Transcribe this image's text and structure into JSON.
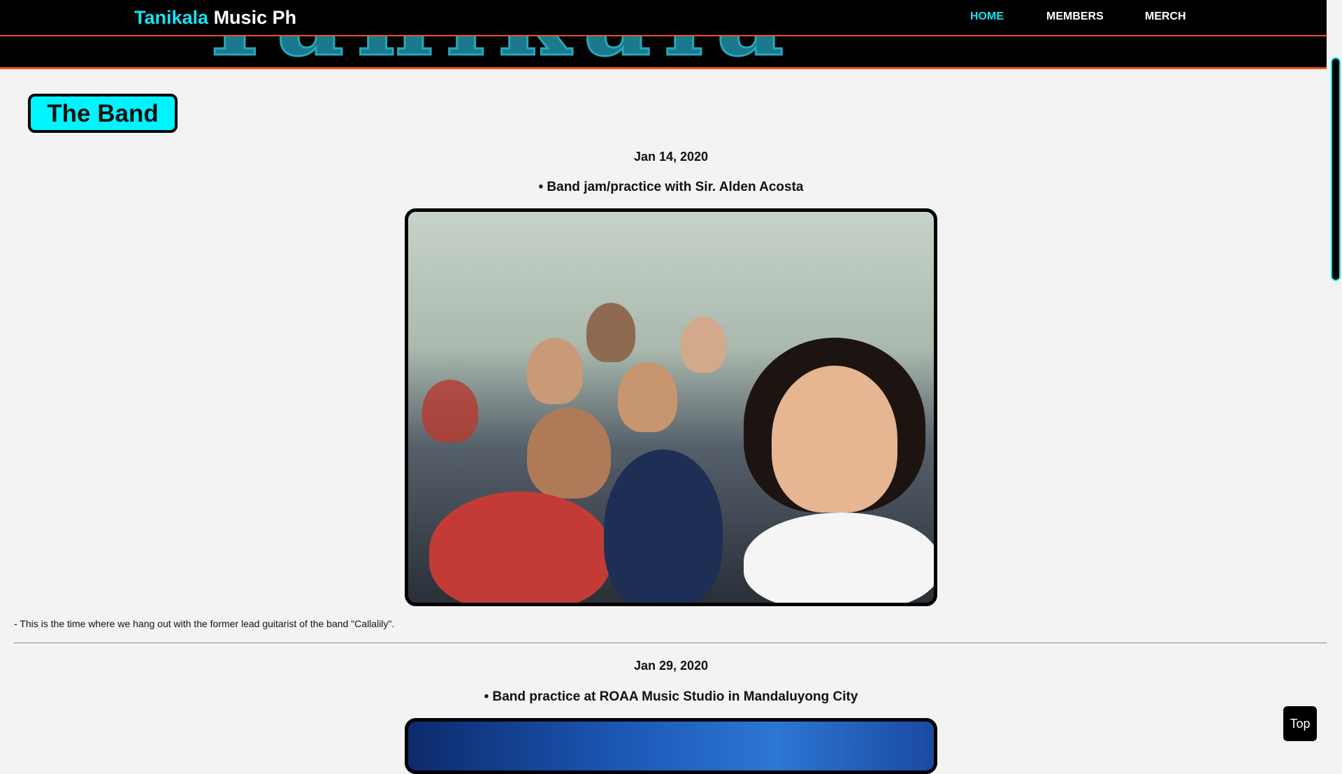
{
  "brand": {
    "accent": "Tanikala",
    "rest": " Music Ph"
  },
  "banner_text": "Tanikala",
  "nav": [
    {
      "label": "HOME",
      "active": true
    },
    {
      "label": "MEMBERS",
      "active": false
    },
    {
      "label": "MERCH",
      "active": false
    }
  ],
  "section_title": "The Band",
  "posts": [
    {
      "date": "Jan 14, 2020",
      "title": "• Band jam/practice with Sir. Alden Acosta",
      "caption": "- This is the time where we hang out with the former lead guitarist of the band \"Callalily\"."
    },
    {
      "date": "Jan 29, 2020",
      "title": "• Band practice at ROAA Music Studio in Mandaluyong City"
    }
  ],
  "top_button": "Top",
  "colors": {
    "accent": "#19e0f0",
    "banner_border": "#e8551f",
    "title_bg": "#00f4ff"
  }
}
